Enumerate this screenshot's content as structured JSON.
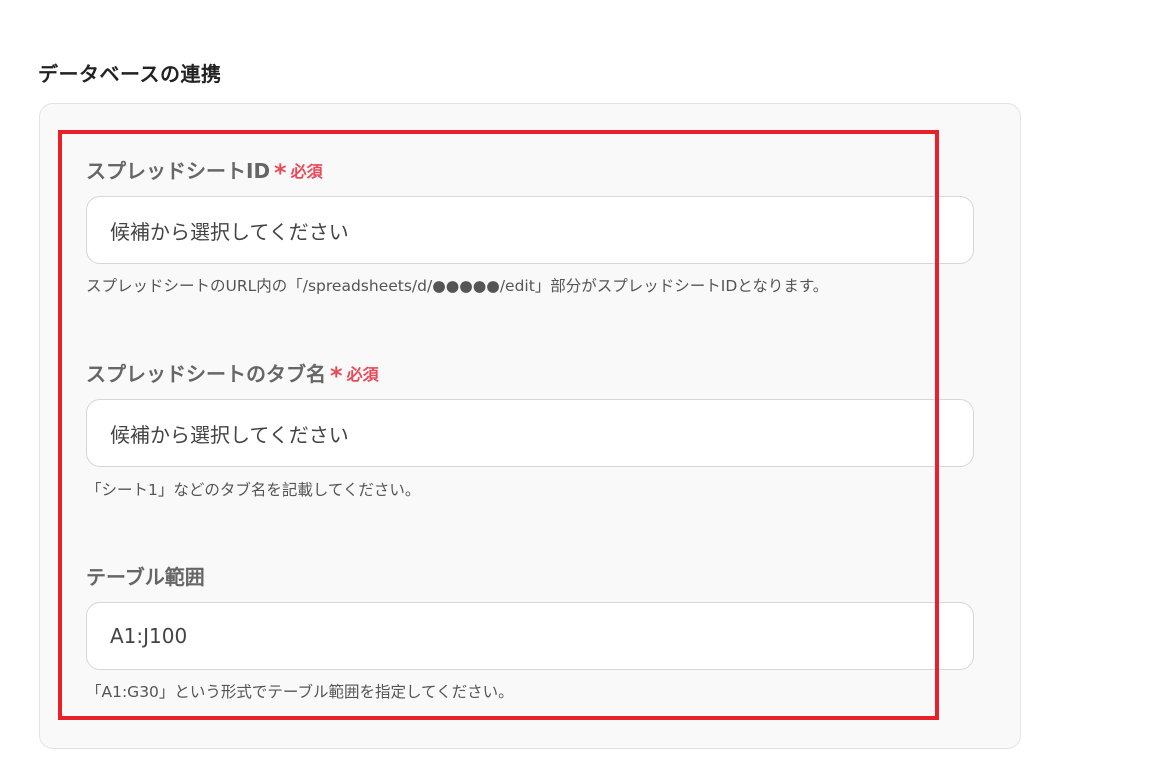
{
  "section": {
    "title": "データベースの連携"
  },
  "fields": [
    {
      "label": "スプレッドシートID",
      "required_star": "*",
      "required_text": "必須",
      "value": "候補から選択してください",
      "help": "スプレッドシートのURL内の「/spreadsheets/d/●●●●●/edit」部分がスプレッドシートIDとなります。"
    },
    {
      "label": "スプレッドシートのタブ名",
      "required_star": "*",
      "required_text": "必須",
      "value": "候補から選択してください",
      "help": "「シート1」などのタブ名を記載してください。"
    },
    {
      "label": "テーブル範囲",
      "value": "A1:J100",
      "help": "「A1:G30」という形式でテーブル範囲を指定してください。"
    }
  ],
  "colors": {
    "highlight_border": "#e8202a",
    "required": "#e94a5a",
    "panel_bg": "#f9f9f9"
  }
}
